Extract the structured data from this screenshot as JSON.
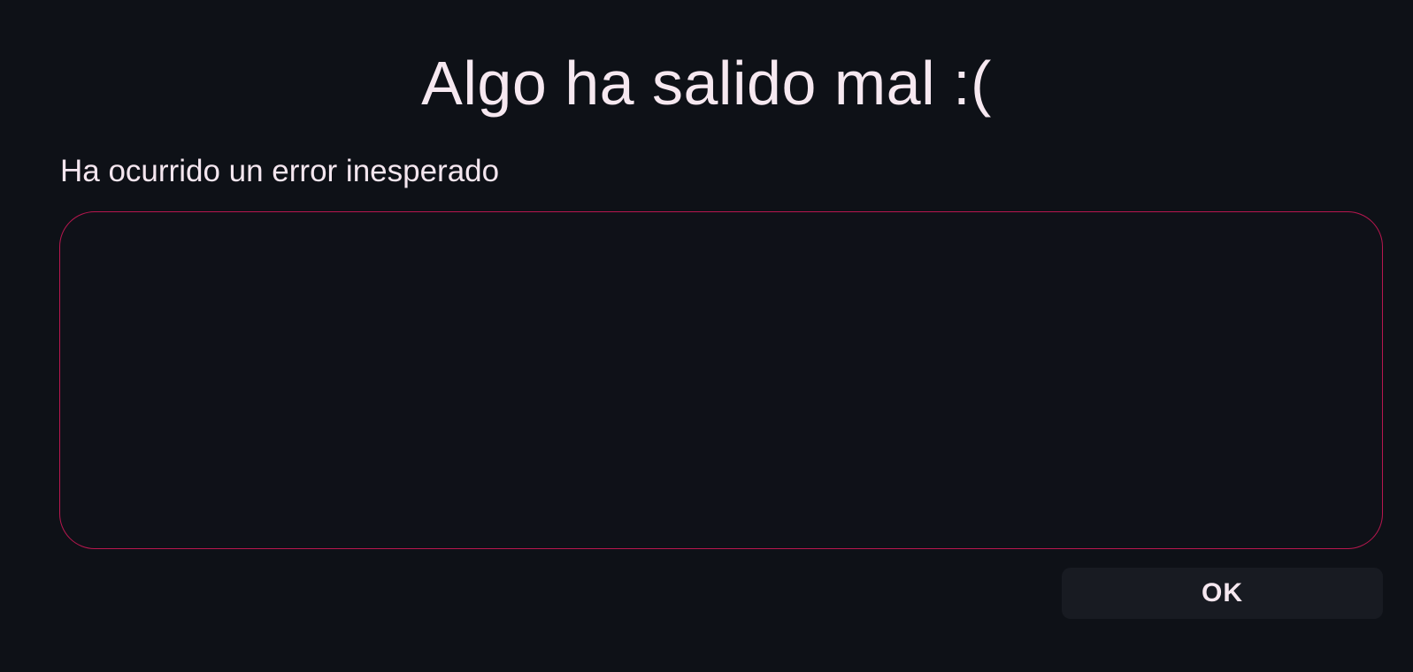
{
  "dialog": {
    "title": "Algo ha salido mal :(",
    "message": "Ha ocurrido un error inesperado",
    "details": "",
    "ok_label": "OK"
  },
  "colors": {
    "background": "#0e1117",
    "text": "#f4e6ef",
    "accent_border": "#b8174f",
    "button_background": "#181b22"
  }
}
